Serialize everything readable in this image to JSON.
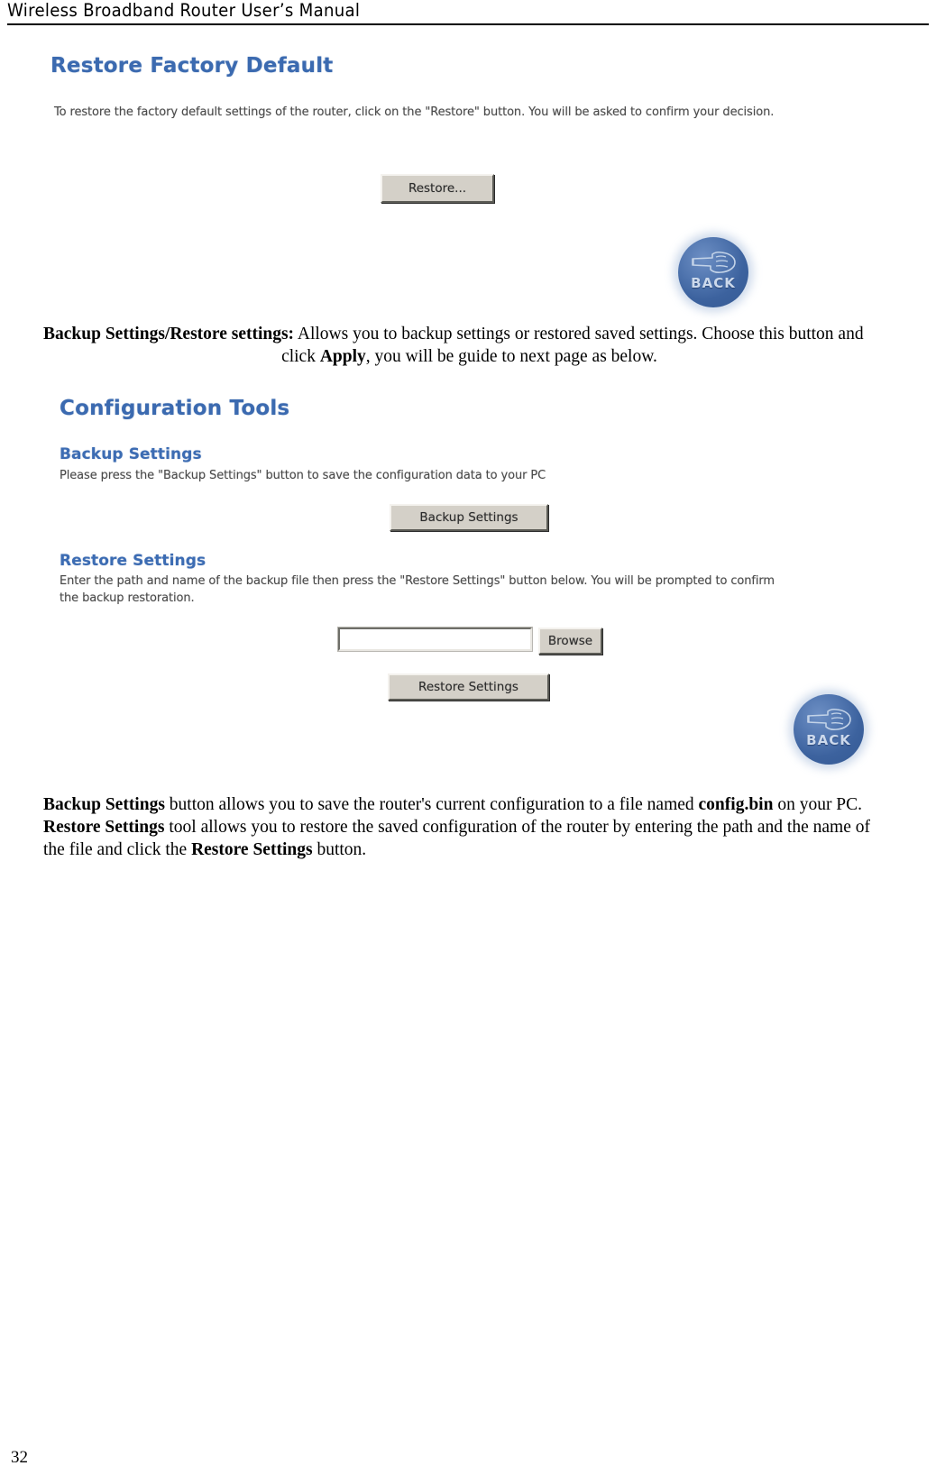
{
  "header": {
    "title": "Wireless Broadband Router User’s Manual"
  },
  "screenshot_restore_factory": {
    "heading": "Restore Factory Default",
    "description": "To restore the factory default settings of the router, click on the \"Restore\" button. You will be asked to confirm your decision.",
    "restore_button": "Restore...",
    "back_button": "BACK"
  },
  "paragraph_backup_restore": {
    "lead": "Backup Settings/Restore settings:",
    "body": " Allows you to backup settings or restored saved settings. Choose this button and",
    "line2_pre": "click ",
    "line2_bold": "Apply",
    "line2_post": ", you will be guide to next page as below."
  },
  "screenshot_config_tools": {
    "heading": "Configuration Tools",
    "backup": {
      "subheading": "Backup Settings",
      "description": "Please press the \"Backup Settings\" button to save the configuration data to your PC",
      "button": "Backup Settings"
    },
    "restore": {
      "subheading": "Restore Settings",
      "description_line1": "Enter the path and name of the backup file then press the \"Restore Settings\" button below. You will be prompted to confirm",
      "description_line2": "the backup restoration.",
      "path_value": "",
      "browse_button": "Browse",
      "button": "Restore Settings"
    },
    "back_button": "BACK"
  },
  "paragraph_footer": {
    "b1": "Backup Settings",
    "t1": " button allows you to save the router's current configuration to a file named ",
    "b2": "config.bin",
    "t2": " on your PC.",
    "b3": "Restore Settings",
    "t3": " tool allows you to restore the saved configuration of the router by entering the path and the name of",
    "t4": "the file and click the ",
    "b4": "Restore Settings",
    "t5": " button."
  },
  "footer": {
    "page_number": "32"
  }
}
